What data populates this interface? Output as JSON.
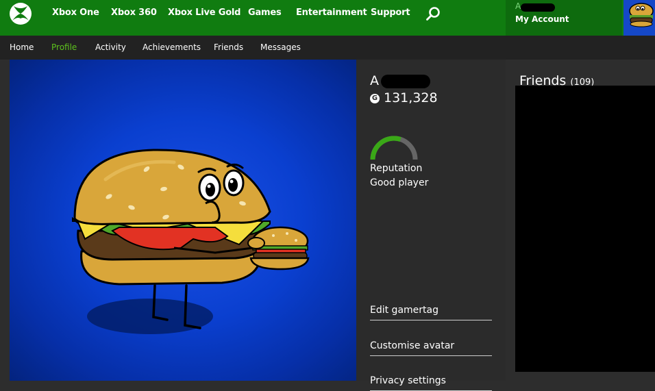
{
  "nav": {
    "items": [
      "Xbox One",
      "Xbox 360",
      "Xbox Live Gold",
      "Games",
      "Entertainment",
      "Support"
    ]
  },
  "account": {
    "name_initial": "A",
    "label": "My Account"
  },
  "subnav": {
    "items": [
      "Home",
      "Profile",
      "Activity",
      "Achievements",
      "Friends",
      "Messages"
    ],
    "active": "Profile"
  },
  "profile": {
    "gamertag_initial": "A",
    "gamerscore_icon": "G",
    "gamerscore": "131,328",
    "reputation_label": "Reputation",
    "reputation_value": "Good player",
    "reputation_level": 0.6
  },
  "actions": {
    "edit_gamertag": "Edit gamertag",
    "customise_avatar": "Customise avatar",
    "privacy_settings": "Privacy settings"
  },
  "friends": {
    "title": "Friends",
    "count": "(109)"
  },
  "colors": {
    "brand_green": "#107c10",
    "active_green": "#5dc21e",
    "avatar_blue": "#0a3fcf"
  },
  "icons": {
    "logo": "xbox-logo-icon",
    "search": "search-icon"
  }
}
